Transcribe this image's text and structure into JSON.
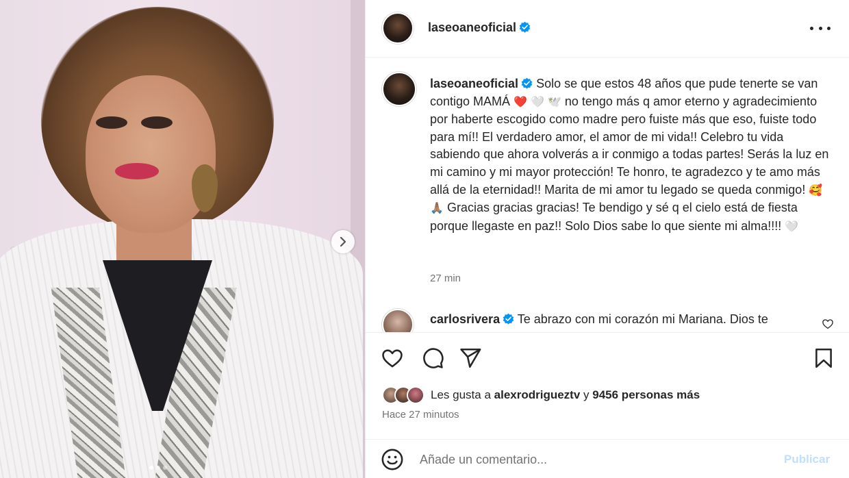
{
  "post": {
    "username": "laseoaneoficial",
    "verified": true,
    "caption_text_1": "Solo se que estos 48 años que pude tenerte se van contigo MAMÁ",
    "caption_text_2": "no tengo más q amor eterno y agradecimiento por haberte escogido como madre pero fuiste más que eso, fuiste todo para mí!! El verdadero amor, el amor de mi vida!! Celebro tu vida sabiendo que ahora volverás a ir conmigo a todas partes! Serás la luz en mi camino y mi mayor protección! Te honro, te agradezco y te amo más allá de la eternidad!! Marita de mi amor tu legado se queda conmigo!",
    "caption_text_3": "Gracias gracias gracias! Te bendigo y sé q el cielo está de fiesta porque llegaste en paz!! Solo Dios sabe lo que siente mi alma!!!!",
    "emoji_red_heart": "❤️",
    "emoji_white_heart": "🤍",
    "emoji_dove": "🕊️",
    "emoji_hearts_face": "🥰",
    "emoji_pray": "🙏🏽",
    "caption_time": "27 min"
  },
  "comment": {
    "username": "carlosrivera",
    "text": "Te abrazo con mi corazón mi Mariana. Dios te"
  },
  "likes": {
    "prefix": "Les gusta a",
    "user": "alexrodrigueztv",
    "conjunction": "y",
    "others": "9456 personas más"
  },
  "post_date": "Hace 27 minutos",
  "add_comment": {
    "placeholder": "Añade un comentario...",
    "publish_label": "Publicar"
  },
  "colors": {
    "accent": "#0095f6",
    "verified": "#0095f6",
    "publish_disabled": "#c0dffd",
    "text": "#262626",
    "secondary_text": "#737373"
  },
  "carousel": {
    "current_index": 1,
    "total": 3
  }
}
